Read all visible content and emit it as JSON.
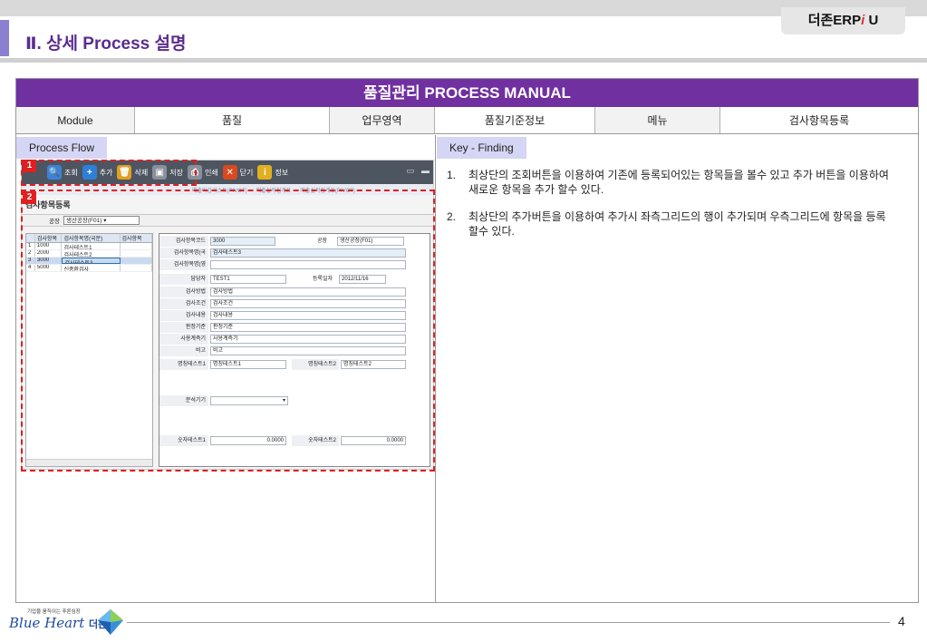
{
  "brand": {
    "prefix": "더존ERP",
    "accent": "i",
    "suffix": " U"
  },
  "page_title": "Ⅱ. 상세 Process 설명",
  "manual": {
    "header": "품질관리 PROCESS MANUAL",
    "info": [
      {
        "label": "Module",
        "value": "품질"
      },
      {
        "label": "업무영역",
        "value": "품질기준정보"
      },
      {
        "label": "메뉴",
        "value": "검사항목등록"
      }
    ]
  },
  "left_section": {
    "title": "Process Flow"
  },
  "right_section": {
    "title": "Key - Finding"
  },
  "findings": [
    {
      "num": "1.",
      "text": "최상단의 조회버튼을 이용하여 기존에 등록되어있는 항목들을 볼수 있고 추가 버튼을 이용하여 새로운 항목을 추가 할수 있다."
    },
    {
      "num": "2.",
      "text": "최상단의 추가버튼을 이용하여 추가시 좌측그리드의 행이 추가되며 우측그리드에 항목을 등록 할수 있다."
    }
  ],
  "badges": [
    "1",
    "2"
  ],
  "screenshot": {
    "toolbar": [
      {
        "label": "조회",
        "icon": "search-icon",
        "color": "#3b82d6"
      },
      {
        "label": "추가",
        "icon": "plus-icon",
        "color": "#2f7fd8"
      },
      {
        "label": "삭제",
        "icon": "trash-icon",
        "color": "#e0a020"
      },
      {
        "label": "저장",
        "icon": "save-icon",
        "color": "#8a909a"
      },
      {
        "label": "인쇄",
        "icon": "print-icon",
        "color": "#8a909a"
      },
      {
        "label": "닫기",
        "icon": "close-icon",
        "color": "#d84a20"
      },
      {
        "label": "정보",
        "icon": "info-icon",
        "color": "#e0b020"
      }
    ],
    "tabs": [
      "매출마감리스트(PIVOT)",
      "매출실적집계표",
      "매출실적집계표(PIVOT)"
    ],
    "screen_title": "검사항목등록",
    "plant_label": "공장",
    "plant_value": "생산공장(F01)",
    "grid_headers": [
      "",
      "검사항목",
      "검사항목명(국문)",
      "검사항목"
    ],
    "grid_rows": [
      [
        "1",
        "1000",
        "검사테스트1",
        ""
      ],
      [
        "2",
        "2000",
        "검사테스트2",
        ""
      ],
      [
        "3",
        "3000",
        "검사테스트3",
        ""
      ],
      [
        "4",
        "5000",
        "신종환검사",
        ""
      ]
    ],
    "fields": {
      "code_label": "검사항목코드",
      "code_value": "3000",
      "plant_label": "공장",
      "plant_value": "생산공장(F01)",
      "name_label": "검사항목명(국",
      "name_value": "검사테스트3",
      "name_en_label": "검사항목명(영",
      "owner_label": "담당자",
      "owner_value": "TEST1",
      "regdate_label": "등록일자",
      "regdate_value": "2012/11/16",
      "method_label": "검사방법",
      "method_value": "검사방법",
      "condition_label": "검사조건",
      "condition_value": "검사조건",
      "content_label": "검사내용",
      "content_value": "검사내용",
      "criteria_label": "판정기준",
      "criteria_value": "판정기준",
      "gauge_label": "사용계측기",
      "gauge_value": "사용계측기",
      "remark_label": "비고",
      "remark_value": "비고",
      "mtest1_label": "명칭테스트1",
      "mtest1_value": "명칭테스트1",
      "mtest2_label": "명칭테스트2",
      "mtest2_value": "명칭테스트2",
      "analyzer_label": "분석기기",
      "ntest1_label": "숫자테스트1",
      "ntest1_value": "0.0000",
      "ntest2_label": "숫자테스트2",
      "ntest2_value": "0.0000"
    }
  },
  "footer": {
    "tagline": "기업을 움직이는 푸른심장",
    "logo_text": "Blue Heart",
    "logo_kr": "더존",
    "page_number": "4"
  }
}
